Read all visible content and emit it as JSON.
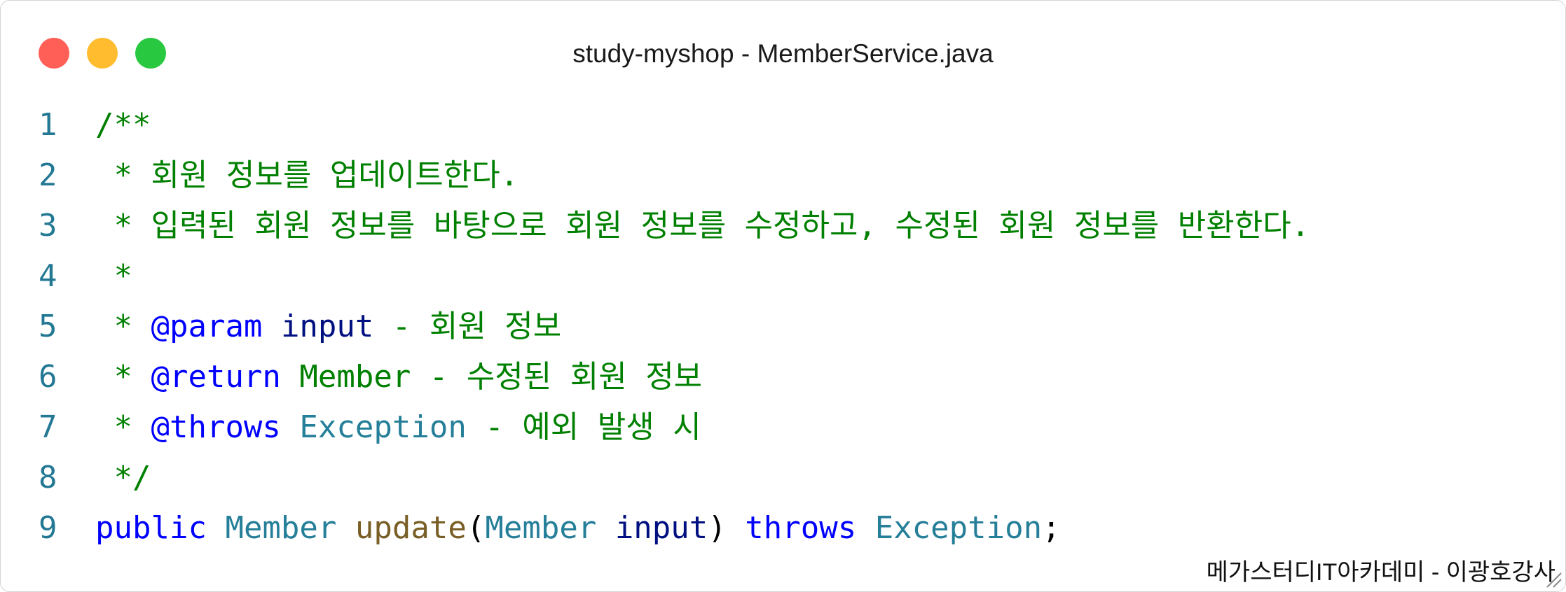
{
  "window": {
    "title": "study-myshop - MemberService.java"
  },
  "colors": {
    "comment": "#008000",
    "doc_tag": "#0000ff",
    "keyword": "#0000ff",
    "type": "#267f99",
    "function": "#795e26",
    "parameter": "#001080",
    "line_number": "#237893"
  },
  "code": {
    "lines": [
      {
        "number": "1",
        "tokens": [
          {
            "text": "/**",
            "kind": "comment"
          }
        ]
      },
      {
        "number": "2",
        "tokens": [
          {
            "text": " * 회원 정보를 업데이트한다.",
            "kind": "comment"
          }
        ]
      },
      {
        "number": "3",
        "tokens": [
          {
            "text": " * 입력된 회원 정보를 바탕으로 회원 정보를 수정하고, 수정된 회원 정보를 반환한다.",
            "kind": "comment"
          }
        ]
      },
      {
        "number": "4",
        "tokens": [
          {
            "text": " *",
            "kind": "comment"
          }
        ]
      },
      {
        "number": "5",
        "tokens": [
          {
            "text": " * ",
            "kind": "comment"
          },
          {
            "text": "@param",
            "kind": "tag"
          },
          {
            "text": " ",
            "kind": "comment"
          },
          {
            "text": "input",
            "kind": "param"
          },
          {
            "text": " - 회원 정보",
            "kind": "comment"
          }
        ]
      },
      {
        "number": "6",
        "tokens": [
          {
            "text": " * ",
            "kind": "comment"
          },
          {
            "text": "@return",
            "kind": "tag"
          },
          {
            "text": " Member - 수정된 회원 정보",
            "kind": "comment"
          }
        ]
      },
      {
        "number": "7",
        "tokens": [
          {
            "text": " * ",
            "kind": "comment"
          },
          {
            "text": "@throws",
            "kind": "tag"
          },
          {
            "text": " ",
            "kind": "comment"
          },
          {
            "text": "Exception",
            "kind": "type"
          },
          {
            "text": " - 예외 발생 시",
            "kind": "comment"
          }
        ]
      },
      {
        "number": "8",
        "tokens": [
          {
            "text": " */",
            "kind": "comment"
          }
        ]
      },
      {
        "number": "9",
        "tokens": [
          {
            "text": "public",
            "kind": "keyword"
          },
          {
            "text": " ",
            "kind": "plain"
          },
          {
            "text": "Member",
            "kind": "type"
          },
          {
            "text": " ",
            "kind": "plain"
          },
          {
            "text": "update",
            "kind": "func"
          },
          {
            "text": "(",
            "kind": "plain"
          },
          {
            "text": "Member",
            "kind": "type"
          },
          {
            "text": " ",
            "kind": "plain"
          },
          {
            "text": "input",
            "kind": "param"
          },
          {
            "text": ") ",
            "kind": "plain"
          },
          {
            "text": "throws",
            "kind": "keyword"
          },
          {
            "text": " ",
            "kind": "plain"
          },
          {
            "text": "Exception",
            "kind": "type"
          },
          {
            "text": ";",
            "kind": "plain"
          }
        ]
      }
    ]
  },
  "watermark": "메가스터디IT아카데미 - 이광호강사"
}
